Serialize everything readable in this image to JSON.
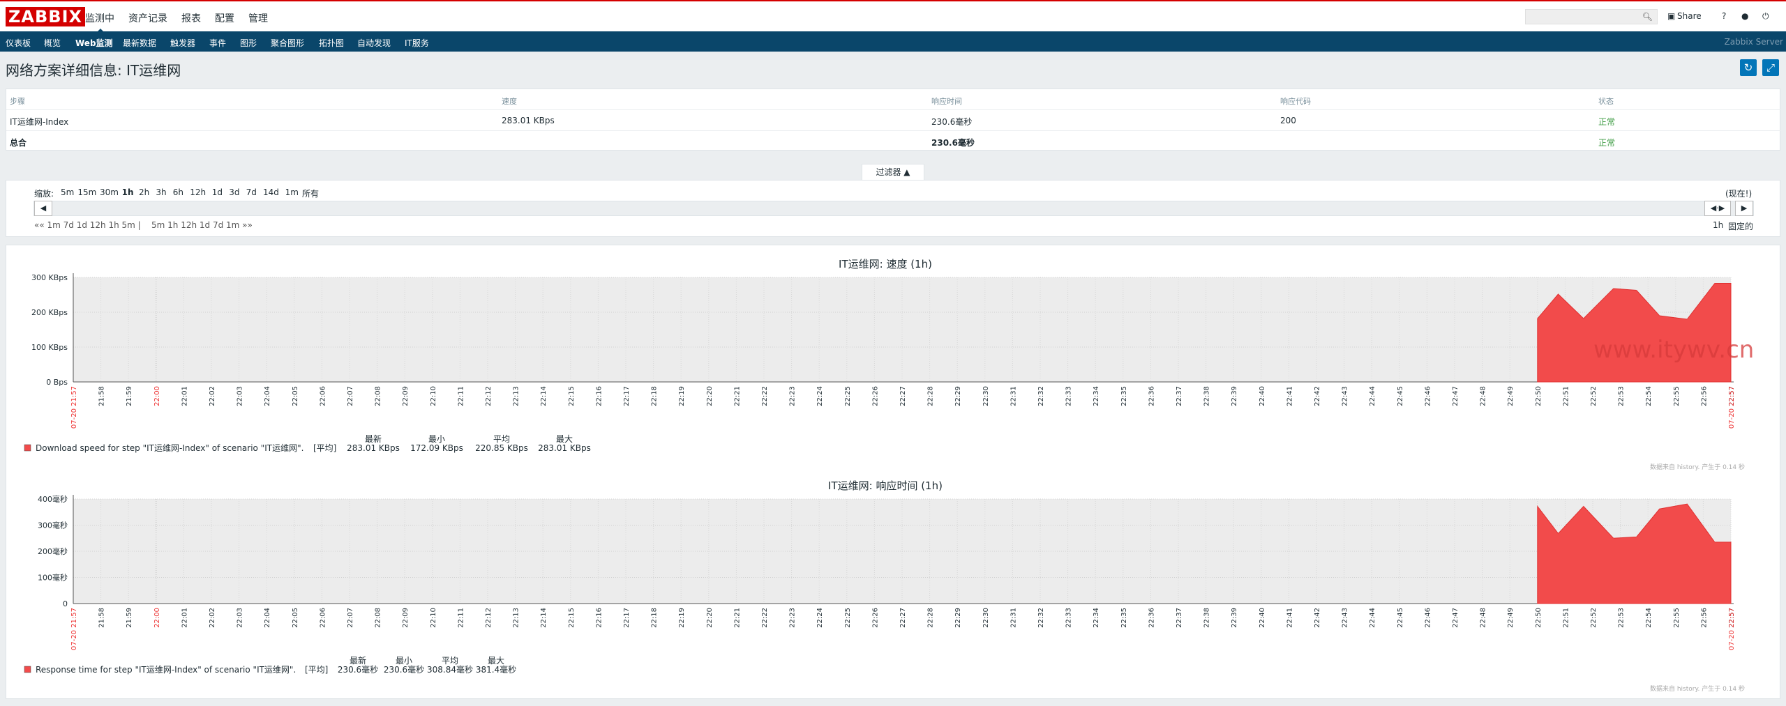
{
  "topbar": {
    "logo": "ZABBIX",
    "menu": [
      {
        "label": "监测中"
      },
      {
        "label": "资产记录"
      },
      {
        "label": "报表"
      },
      {
        "label": "配置"
      },
      {
        "label": "管理"
      }
    ],
    "share": "Share",
    "help": "?",
    "user_icon": "user-icon",
    "power_icon": "power-icon",
    "share_icon": "share-icon",
    "search_icon": "search-icon"
  },
  "submenu": {
    "items": [
      {
        "label": "仪表板"
      },
      {
        "label": "概览"
      },
      {
        "label": "Web监测"
      },
      {
        "label": "最新数据"
      },
      {
        "label": "触发器"
      },
      {
        "label": "事件"
      },
      {
        "label": "图形"
      },
      {
        "label": "聚合图形"
      },
      {
        "label": "拓扑图"
      },
      {
        "label": "自动发现"
      },
      {
        "label": "IT服务"
      }
    ],
    "server": "Zabbix Server"
  },
  "page": {
    "title": "网络方案详细信息: IT运维网",
    "refresh_icon": "refresh-icon",
    "fullscreen_icon": "fullscreen-icon"
  },
  "table": {
    "headers": [
      "步骤",
      "速度",
      "响应时间",
      "响应代码",
      "状态"
    ],
    "rows": [
      {
        "step": "IT运维网-Index",
        "speed": "283.01 KBps",
        "time": "230.6毫秒",
        "code": "200",
        "status": "正常"
      }
    ],
    "total": {
      "label": "总合",
      "time": "230.6毫秒",
      "status": "正常"
    }
  },
  "filter": {
    "tab": "过滤器 ▲",
    "zoom_label": "缩放:",
    "zoom": [
      "5m",
      "15m",
      "30m",
      "1h",
      "2h",
      "3h",
      "6h",
      "12h",
      "1d",
      "3d",
      "7d",
      "14d",
      "1m",
      "所有"
    ],
    "zoom_active": "1h",
    "now_label": "(现在!)",
    "nav_back": [
      "«",
      "1m",
      "7d",
      "1d",
      "12h",
      "1h",
      "5m",
      "|"
    ],
    "nav_fwd": [
      "5m",
      "1h",
      "12h",
      "1d",
      "7d",
      "1m",
      "»"
    ],
    "nav_back_text": "«« 1m 7d 1d 12h 1h 5m |",
    "nav_fwd_text": "5m 1h 12h 1d 7d 1m »»",
    "period": "1h",
    "fixed": "固定的"
  },
  "chart_data": [
    {
      "type": "area",
      "title": "IT运维网: 速度 (1h)",
      "y_ticks": [
        "300 KBps",
        "200 KBps",
        "100 KBps",
        "0 Bps"
      ],
      "ylim": [
        0,
        300
      ],
      "x_ticks": [
        "07-20 21:57",
        "21:58",
        "21:59",
        "22:00",
        "22:01",
        "22:02",
        "22:03",
        "22:04",
        "22:05",
        "22:06",
        "22:07",
        "22:08",
        "22:09",
        "22:10",
        "22:11",
        "22:12",
        "22:13",
        "22:14",
        "22:15",
        "22:16",
        "22:17",
        "22:18",
        "22:19",
        "22:20",
        "22:21",
        "22:22",
        "22:23",
        "22:24",
        "22:25",
        "22:26",
        "22:27",
        "22:28",
        "22:29",
        "22:30",
        "22:31",
        "22:32",
        "22:33",
        "22:34",
        "22:35",
        "22:36",
        "22:37",
        "22:38",
        "22:39",
        "22:40",
        "22:41",
        "22:42",
        "22:43",
        "22:44",
        "22:45",
        "22:46",
        "22:47",
        "22:48",
        "22:49",
        "22:50",
        "22:51",
        "22:52",
        "22:53",
        "22:54",
        "22:55",
        "22:56",
        "22:57",
        "07-20 22:57"
      ],
      "color": "#f24b4b",
      "points": [
        {
          "x": "22:50",
          "y": 182
        },
        {
          "x": "22:50:45",
          "y": 252
        },
        {
          "x": "22:51:40",
          "y": 182
        },
        {
          "x": "22:52:45",
          "y": 268
        },
        {
          "x": "22:53:35",
          "y": 263
        },
        {
          "x": "22:54:25",
          "y": 190
        },
        {
          "x": "22:55:25",
          "y": 180
        },
        {
          "x": "22:56:25",
          "y": 283
        }
      ],
      "legend": {
        "series": "Download speed for step \"IT运维网-Index\" of scenario \"IT运维网\".",
        "func": "[平均]",
        "headers": [
          "最新",
          "最小",
          "平均",
          "最大"
        ],
        "values": [
          "283.01 KBps",
          "172.09 KBps",
          "220.85 KBps",
          "283.01 KBps"
        ]
      },
      "footer": "数据来自 history. 产生于 0.14 秒"
    },
    {
      "type": "area",
      "title": "IT运维网: 响应时间 (1h)",
      "y_ticks": [
        "400毫秒",
        "300毫秒",
        "200毫秒",
        "100毫秒",
        "0"
      ],
      "ylim": [
        0,
        400
      ],
      "x_ticks": [
        "07-20 21:57",
        "21:58",
        "21:59",
        "22:00",
        "22:01",
        "22:02",
        "22:03",
        "22:04",
        "22:05",
        "22:06",
        "22:07",
        "22:08",
        "22:09",
        "22:10",
        "22:11",
        "22:12",
        "22:13",
        "22:14",
        "22:15",
        "22:16",
        "22:17",
        "22:18",
        "22:19",
        "22:20",
        "22:21",
        "22:22",
        "22:23",
        "22:24",
        "22:25",
        "22:26",
        "22:27",
        "22:28",
        "22:29",
        "22:30",
        "22:31",
        "22:32",
        "22:33",
        "22:34",
        "22:35",
        "22:36",
        "22:37",
        "22:38",
        "22:39",
        "22:40",
        "22:41",
        "22:42",
        "22:43",
        "22:44",
        "22:45",
        "22:46",
        "22:47",
        "22:48",
        "22:49",
        "22:50",
        "22:51",
        "22:52",
        "22:53",
        "22:54",
        "22:55",
        "22:56",
        "22:57",
        "07-20 22:57"
      ],
      "color": "#f24b4b",
      "points": [
        {
          "x": "22:50",
          "y": 372
        },
        {
          "x": "22:50:45",
          "y": 268
        },
        {
          "x": "22:51:40",
          "y": 372
        },
        {
          "x": "22:52:45",
          "y": 250
        },
        {
          "x": "22:53:35",
          "y": 255
        },
        {
          "x": "22:54:25",
          "y": 362
        },
        {
          "x": "22:55:25",
          "y": 381
        },
        {
          "x": "22:56:25",
          "y": 235
        }
      ],
      "legend": {
        "series": "Response time for step \"IT运维网-Index\" of scenario \"IT运维网\".",
        "func": "[平均]",
        "headers": [
          "最新",
          "最小",
          "平均",
          "最大"
        ],
        "values": [
          "230.6毫秒",
          "230.6毫秒",
          "308.84毫秒",
          "381.4毫秒"
        ]
      },
      "footer": "数据来自 history. 产生于 0.14 秒"
    }
  ],
  "watermark": "www.itywv.cn"
}
